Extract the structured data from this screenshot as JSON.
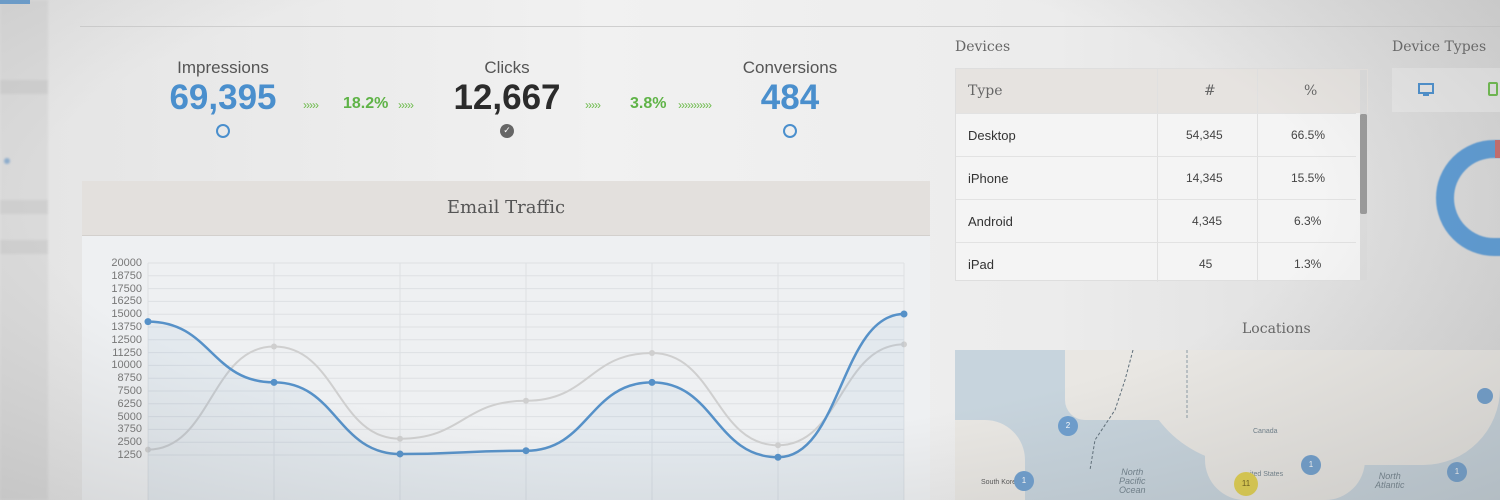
{
  "metrics": {
    "impressions": {
      "label": "Impressions",
      "value": "69,395"
    },
    "clicks": {
      "label": "Clicks",
      "value": "12,667"
    },
    "conversions": {
      "label": "Conversions",
      "value": "484"
    },
    "rate_impr_clicks": "18.2%",
    "rate_clicks_conv": "3.8%",
    "arrows_short": "›››››",
    "arrows_long": "›››››››››››"
  },
  "chart": {
    "title": "Email Traffic",
    "y_ticks": [
      "20000",
      "18750",
      "17500",
      "16250",
      "15000",
      "13750",
      "12500",
      "11250",
      "10000",
      "8750",
      "7500",
      "6250",
      "5000",
      "3750",
      "2500",
      "1250"
    ]
  },
  "chart_data": {
    "type": "line",
    "title": "Email Traffic",
    "ylim": [
      0,
      20000
    ],
    "grid": true,
    "series": [
      {
        "name": "",
        "color": "#5691c8",
        "values": [
          14600,
          9000,
          2400,
          2700,
          9000,
          2100,
          15300
        ]
      },
      {
        "name": "",
        "color": "#cfcfcf",
        "values": [
          2800,
          12300,
          3800,
          7300,
          11700,
          3200,
          12500
        ]
      }
    ]
  },
  "devices": {
    "title": "Devices",
    "headers": {
      "type": "Type",
      "count": "#",
      "percent": "%"
    },
    "rows": [
      {
        "type": "Desktop",
        "count": "54,345",
        "percent": "66.5%"
      },
      {
        "type": "iPhone",
        "count": "14,345",
        "percent": "15.5%"
      },
      {
        "type": "Android",
        "count": "4,345",
        "percent": "6.3%"
      },
      {
        "type": "iPad",
        "count": "45",
        "percent": "1.3%"
      }
    ]
  },
  "device_types": {
    "title": "Device Types"
  },
  "locations": {
    "title": "Locations",
    "labels": {
      "canada": "Canada",
      "north_pacific": "North\nPacific\nOcean",
      "north_atlantic": "North\nAtlantic",
      "united_states": "ited States",
      "south_korea": "South Korea"
    },
    "clusters": [
      {
        "id": "c1",
        "count": "2"
      },
      {
        "id": "c2",
        "count": "1"
      },
      {
        "id": "c3",
        "count": "1"
      },
      {
        "id": "c4",
        "count": "11"
      },
      {
        "id": "c5",
        "count": "1"
      }
    ]
  }
}
